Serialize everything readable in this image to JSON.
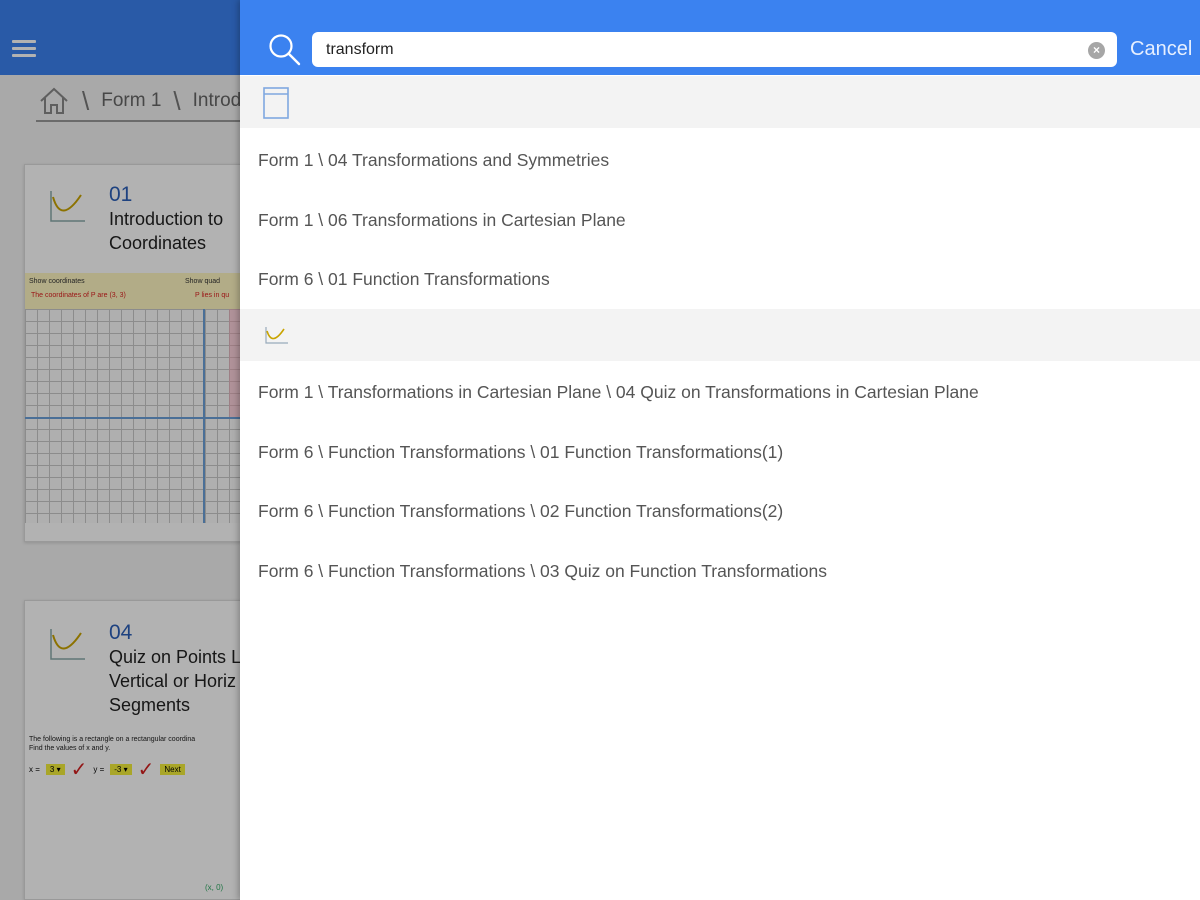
{
  "background": {
    "breadcrumb": [
      {
        "label": "Form 1"
      },
      {
        "label": "Introd"
      }
    ],
    "cards": [
      {
        "number": "01",
        "title": "Introduction to\nCoordinates",
        "preview": {
          "show_coordinates": "Show coordinates",
          "show_quadrant": "Show quad",
          "coordinates_text": "The coordinates of P are (3, 3)",
          "quadrant_text": "P lies in qu"
        }
      },
      {
        "number": "04",
        "title": "Quiz on Points L\nVertical or Horiz\nSegments",
        "preview": {
          "question_line1": "The following is a rectangle on a rectangular coordina",
          "question_line2": "Find the values of x and y.",
          "x_label": "x =",
          "x_value": "3 ▾",
          "y_label": "y =",
          "y_value": "-3 ▾",
          "next_label": "Next",
          "point_label": "(x, 0)"
        }
      }
    ]
  },
  "search": {
    "query": "transform",
    "cancel_label": "Cancel",
    "clear_glyph": "×"
  },
  "results": {
    "topics": [
      {
        "label": "Form 1 \\ 04 Transformations and Symmetries"
      },
      {
        "label": "Form 1 \\ 06 Transformations in Cartesian Plane"
      },
      {
        "label": "Form 6 \\ 01 Function Transformations"
      }
    ],
    "activities": [
      {
        "label": "Form 1 \\ Transformations in Cartesian Plane \\ 04 Quiz on Transformations in Cartesian Plane"
      },
      {
        "label": "Form 6 \\ Function Transformations \\ 01 Function Transformations(1)"
      },
      {
        "label": "Form 6 \\ Function Transformations \\ 02 Function Transformations(2)"
      },
      {
        "label": "Form 6 \\ Function Transformations \\ 03 Quiz on Function Transformations"
      }
    ]
  },
  "colors": {
    "header_blue": "#3b82f0",
    "result_text": "#555555",
    "section_bg": "#f3f3f3"
  },
  "icons": [
    "hamburger-icon",
    "home-icon",
    "graph-icon",
    "search-icon",
    "clear-icon",
    "document-icon"
  ]
}
